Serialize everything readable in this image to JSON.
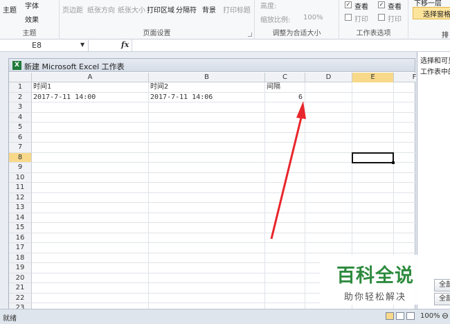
{
  "ribbon": {
    "theme_button": "主题",
    "fonts_button": "字体",
    "effects_button": "效果",
    "theme_group": "主题",
    "margins_button": "页边距",
    "orientation_button": "纸张方向",
    "size_button": "纸张大小",
    "print_area_button": "打印区域",
    "breaks_button": "分隔符",
    "background_button": "背景",
    "print_titles_button": "打印标题",
    "page_setup_group": "页面设置",
    "height_label": "高度:",
    "scale_label": "缩放比例:",
    "scale_value": "100%",
    "scale_group": "调整为合适大小",
    "gridlines_view": "查看",
    "gridlines_print": "打印",
    "headings_view": "查看",
    "headings_print": "打印",
    "sheet_options_group": "工作表选项",
    "move_layer_fragment": "下移一层",
    "selection_pane": "选择窗格",
    "arrange_group_fragment": "排"
  },
  "formula_bar": {
    "name_box": "E8",
    "fx": "fx",
    "formula_value": ""
  },
  "workbook": {
    "title": "新建 Microsoft Excel 工作表",
    "active_cell": "E8",
    "columns": [
      "A",
      "B",
      "C",
      "D",
      "E",
      "F"
    ],
    "rows": [
      "1",
      "2",
      "3",
      "4",
      "5",
      "6",
      "7",
      "8",
      "9",
      "10",
      "11",
      "12",
      "13",
      "14",
      "15",
      "16",
      "17",
      "18",
      "19",
      "20",
      "21",
      "22",
      "23"
    ],
    "cells": {
      "A1": "时间1",
      "B1": "时间2",
      "C1": "间隔",
      "A2": "2017-7-11 14:00",
      "B2": "2017-7-11 14:06",
      "C2": "6"
    }
  },
  "task_pane": {
    "title": "选择和可见",
    "subtitle": "工作表中的",
    "show_all_button": "全部",
    "hide_all_button": "全部"
  },
  "status": {
    "ready": "就绪",
    "zoom": "100%"
  },
  "watermark": {
    "title": "百科全说",
    "subtitle": "助你轻松解决"
  },
  "colors": {
    "active_header": "#f8d98a",
    "arrow": "#e8262b",
    "watermark_green": "#2e8b3e"
  }
}
